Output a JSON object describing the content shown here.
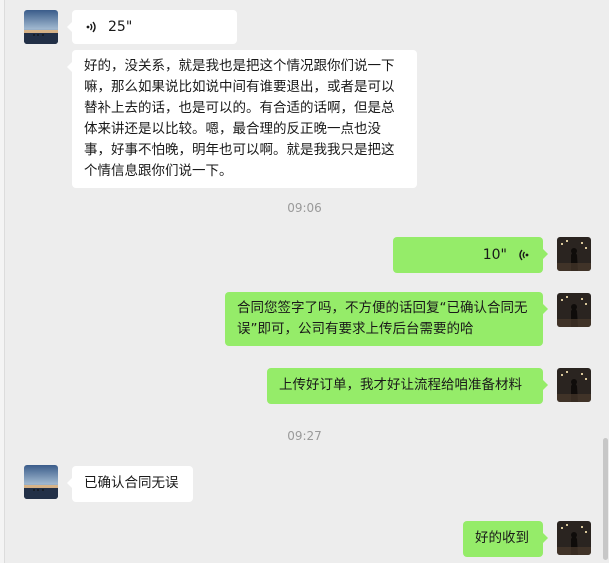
{
  "messages": {
    "m1": {
      "duration": "25\""
    },
    "m2": {
      "text": "好的，没关系，就是我也是把这个情况跟你们说一下嘛，那么如果说比如说中间有谁要退出，或者是可以替补上去的话，也是可以的。有合适的话啊，但是总体来讲还是以比较。嗯，最合理的反正晚一点也没事，好事不怕晚，明年也可以啊。就是我我只是把这个情信息跟你们说一下。"
    },
    "ts1": "09:06",
    "m3": {
      "duration": "10\""
    },
    "m4": {
      "text": "合同您签字了吗，不方便的话回复“已确认合同无误”即可，公司有要求上传后台需要的哈"
    },
    "m5": {
      "text": "上传好订单，我才好让流程给咱准备材料"
    },
    "ts2": "09:27",
    "m6": {
      "text": "已确认合同无误"
    },
    "m7": {
      "text": "好的收到"
    }
  },
  "colors": {
    "background": "#ededed",
    "bubble_in": "#ffffff",
    "bubble_out": "#95ec69",
    "timestamp": "#9a9a9a"
  },
  "icons": {
    "voice_in": "voice-wave-icon",
    "voice_out": "voice-wave-icon"
  }
}
